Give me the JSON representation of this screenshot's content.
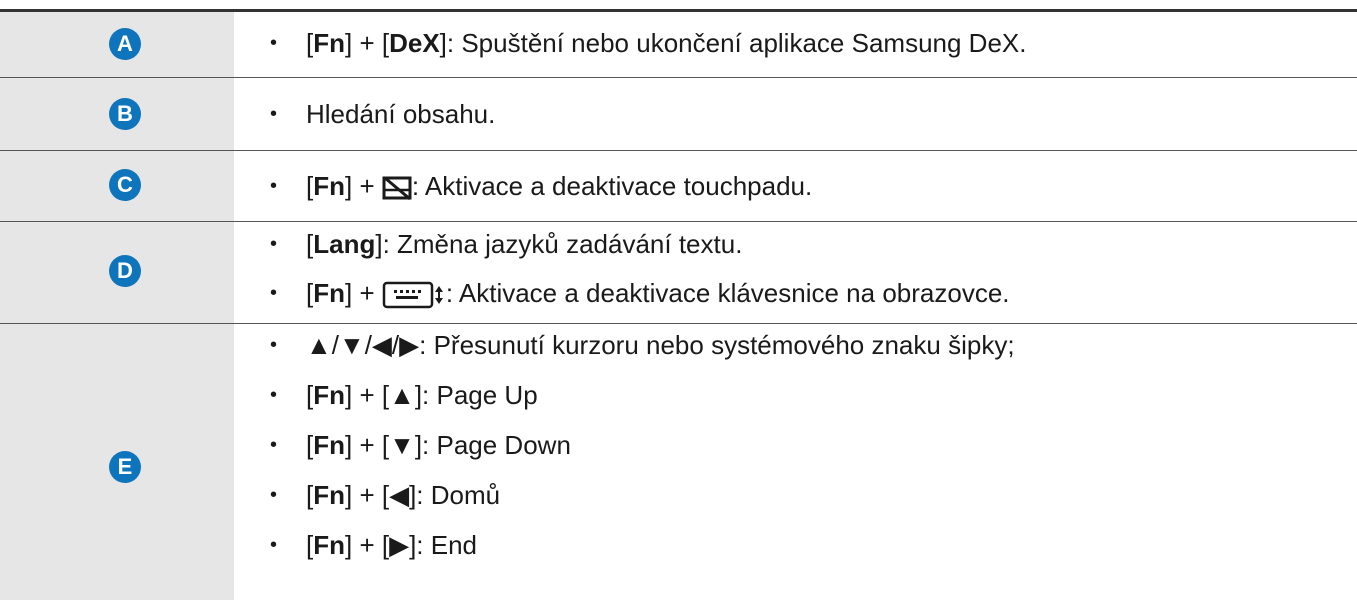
{
  "rows": [
    {
      "badge": "A",
      "lines": [
        {
          "pre": "[",
          "k1": "Fn",
          "mid": "] + [",
          "k2": "DeX",
          "post": "]: Spuštění nebo ukončení aplikace Samsung DeX."
        }
      ]
    },
    {
      "badge": "B",
      "lines": [
        {
          "text": "Hledání obsahu."
        }
      ]
    },
    {
      "badge": "C",
      "lines": [
        {
          "pre": "[",
          "k1": "Fn",
          "mid": "] + ",
          "icon": "touchpad-off-icon",
          "post": ": Aktivace a deaktivace touchpadu."
        }
      ]
    },
    {
      "badge": "D",
      "lines": [
        {
          "pre": "[",
          "k1": "Lang",
          "post": "]: Změna jazyků zadávání textu."
        },
        {
          "pre": "[",
          "k1": "Fn",
          "mid": "] + ",
          "icon": "keyboard-icon",
          "post": ": Aktivace a deaktivace klávesnice na obrazovce."
        }
      ]
    },
    {
      "badge": "E",
      "lines": [
        {
          "text": "▲/▼/◀/▶: Přesunutí kurzoru nebo systémového znaku šipky;"
        },
        {
          "pre": "[",
          "k1": "Fn",
          "mid": "] + [",
          "arrow": "▲",
          "post": "]: Page Up"
        },
        {
          "pre": "[",
          "k1": "Fn",
          "mid": "] + [",
          "arrow": "▼",
          "post": "]: Page Down"
        },
        {
          "pre": "[",
          "k1": "Fn",
          "mid": "] + [",
          "arrow": "◀",
          "post": "]: Domů"
        },
        {
          "pre": "[",
          "k1": "Fn",
          "mid": "] + [",
          "arrow": "▶",
          "post": "]: End"
        }
      ]
    }
  ],
  "bullet_char": "•",
  "colors": {
    "badge": "#0e75bd",
    "label_bg": "#e6e6e6"
  }
}
